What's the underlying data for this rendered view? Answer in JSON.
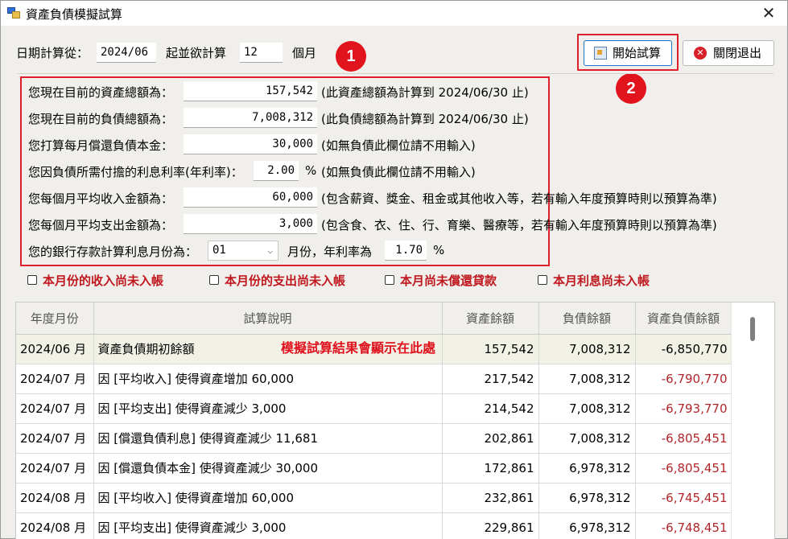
{
  "window": {
    "title": "資產負債模擬試算",
    "close_glyph": "✕"
  },
  "header": {
    "date_from_label": "日期計算從：",
    "date_from_value": "2024/06",
    "months_label_prefix": "起並欲計算",
    "months_value": "12",
    "months_label_suffix": "個月"
  },
  "buttons": {
    "start_label": "開始試算",
    "close_label": "關閉退出",
    "start_icon": "run-icon",
    "close_icon": "stop-icon"
  },
  "markers": {
    "first": "1",
    "second": "2"
  },
  "form": {
    "assets_label": "您現在目前的資產總額為：",
    "assets_value": "157,542",
    "assets_note": "(此資產總額為計算到 2024/06/30 止)",
    "liab_label": "您現在目前的負債總額為：",
    "liab_value": "7,008,312",
    "liab_note": "(此負債總額為計算到 2024/06/30 止)",
    "principal_label": "您打算每月償還負債本金：",
    "principal_value": "30,000",
    "principal_note": "(如無負債此欄位請不用輸入)",
    "rate_label": "您因負債所需付擔的利息利率(年利率)：",
    "rate_value": "2.00",
    "rate_unit": "%",
    "rate_note": "(如無負債此欄位請不用輸入)",
    "income_label": "您每個月平均收入金額為：",
    "income_value": "60,000",
    "income_note": "(包含薪資、獎金、租金或其他收入等，若有輸入年度預算時則以預算為準)",
    "expense_label": "您每個月平均支出金額為：",
    "expense_value": "3,000",
    "expense_note": "(包含食、衣、住、行、育樂、醫療等，若有輸入年度預算時則以預算為準)",
    "bank_month_label": "您的銀行存款計算利息月份為：",
    "bank_month_value": "01",
    "bank_rate_label": "月份，年利率為",
    "bank_rate_value": "1.70",
    "bank_rate_unit": "%"
  },
  "checkboxes": [
    {
      "label": "本月份的收入尚未入帳",
      "checked": false
    },
    {
      "label": "本月份的支出尚未入帳",
      "checked": false
    },
    {
      "label": "本月尚未償還貸款",
      "checked": false
    },
    {
      "label": "本月利息尚未入帳",
      "checked": false
    }
  ],
  "grid": {
    "columns": [
      "年度月份",
      "試算說明",
      "資產餘額",
      "負債餘額",
      "資產負債餘額"
    ],
    "note": "模擬試算結果會顯示在此處",
    "rows": [
      {
        "month": "2024/06 月",
        "desc": "資產負債期初餘額",
        "assets": "157,542",
        "liab": "7,008,312",
        "net": "-6,850,770"
      },
      {
        "month": "2024/07 月",
        "desc": "因 [平均收入] 使得資產增加 60,000",
        "assets": "217,542",
        "liab": "7,008,312",
        "net": "-6,790,770"
      },
      {
        "month": "2024/07 月",
        "desc": "因 [平均支出] 使得資產減少 3,000",
        "assets": "214,542",
        "liab": "7,008,312",
        "net": "-6,793,770"
      },
      {
        "month": "2024/07 月",
        "desc": "因 [償還負債利息] 使得資產減少 11,681",
        "assets": "202,861",
        "liab": "7,008,312",
        "net": "-6,805,451"
      },
      {
        "month": "2024/07 月",
        "desc": "因 [償還負債本金] 使得資產減少 30,000",
        "assets": "172,861",
        "liab": "6,978,312",
        "net": "-6,805,451"
      },
      {
        "month": "2024/08 月",
        "desc": "因 [平均收入] 使得資產增加 60,000",
        "assets": "232,861",
        "liab": "6,978,312",
        "net": "-6,745,451"
      },
      {
        "month": "2024/08 月",
        "desc": "因 [平均支出] 使得資產減少 3,000",
        "assets": "229,861",
        "liab": "6,978,312",
        "net": "-6,748,451"
      }
    ]
  },
  "colors": {
    "highlight_red": "#e01e2b",
    "negative_text": "#b1262b",
    "first_row_bg": "#f2f1e6"
  }
}
